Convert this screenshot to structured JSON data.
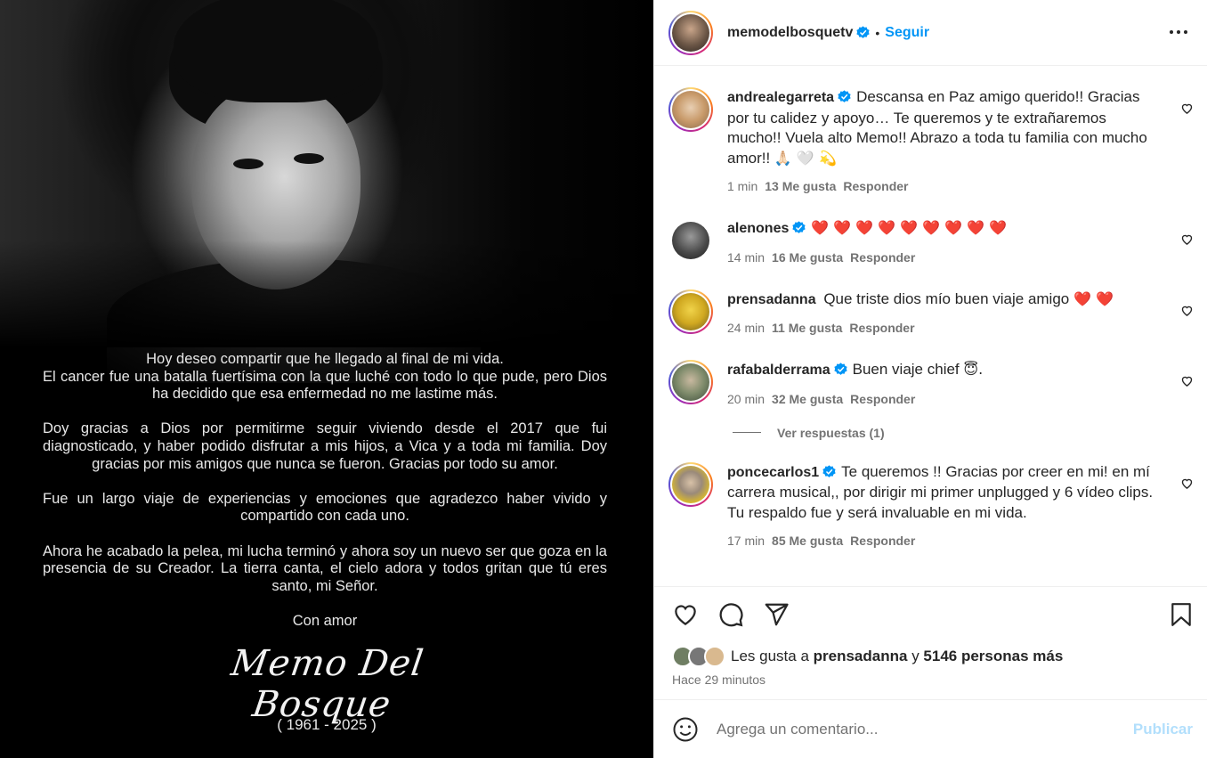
{
  "post": {
    "author": "memodelbosquetv",
    "follow_label": "Seguir",
    "separator": "•",
    "more_icon": "more-horizontal-icon"
  },
  "image": {
    "letter": [
      "Hoy deseo compartir que he llegado al final de mi vida.\nEl cancer fue una batalla fuertísima con la que luché con todo lo que pude, pero Dios ha decidido que esa enfermedad no me lastime más.",
      "Doy gracias a Dios por permitirme seguir viviendo desde el 2017 que fui diagnosticado, y haber podido disfrutar a mis hijos, a Vica y a toda mi familia. Doy gracias por mis amigos que nunca se fueron. Gracias por todo su amor.",
      "Fue un largo viaje de experiencias y emociones que agradezco haber vivido y compartido con cada uno.",
      "Ahora he acabado la pelea, mi lucha terminó y ahora soy un nuevo ser que goza en la presencia de su Creador.  La tierra canta, el cielo adora y todos gritan que tú eres santo, mi Señor.",
      "Con amor"
    ],
    "signature": "Memo Del Bosque",
    "dates": "( 1961 - 2025 )"
  },
  "comments": [
    {
      "user": "andrealegarreta",
      "verified": true,
      "text": "Descansa en Paz amigo querido!! Gracias por tu calidez y apoyo… Te queremos y te extrañaremos mucho!! Vuela alto Memo!! Abrazo a toda tu familia con mucho amor!!",
      "emojis": "🙏🏻 🤍 💫",
      "time": "1 min",
      "likes": "13 Me gusta",
      "reply": "Responder",
      "ring": true,
      "avatar_color": "#d9b98f"
    },
    {
      "user": "alenones",
      "verified": true,
      "text": "",
      "emojis": "❤️ ❤️ ❤️ ❤️ ❤️ ❤️ ❤️ ❤️ ❤️",
      "time": "14 min",
      "likes": "16 Me gusta",
      "reply": "Responder",
      "ring": false,
      "avatar_color": "#555555"
    },
    {
      "user": "prensadanna",
      "verified": false,
      "text": "Que triste dios mío buen viaje amigo",
      "emojis": "❤️ ❤️",
      "time": "24 min",
      "likes": "11 Me gusta",
      "reply": "Responder",
      "ring": true,
      "avatar_color": "#e0c23a"
    },
    {
      "user": "rafabalderrama",
      "verified": true,
      "text": "Buen viaje chief",
      "emojis": "😇.",
      "time": "20 min",
      "likes": "32 Me gusta",
      "reply": "Responder",
      "ring": true,
      "avatar_color": "#6f7e63"
    },
    {
      "user": "poncecarlos1",
      "verified": true,
      "text": "Te queremos !! Gracias por creer en mi! en mí carrera musical,, por dirigir mi primer unplugged y 6 vídeo clips. Tu respaldo fue y será invaluable en mi vida.",
      "emojis": "",
      "time": "17 min",
      "likes": "85 Me gusta",
      "reply": "Responder",
      "ring": true,
      "avatar_color": "#e6c21c"
    }
  ],
  "view_replies": "Ver respuestas (1)",
  "likes": {
    "prefix": "Les gusta a",
    "user": "prensadanna",
    "conj": "y",
    "others": "5146 personas más"
  },
  "time_ago": "Hace 29 minutos",
  "composer": {
    "placeholder": "Agrega un comentario...",
    "publish": "Publicar"
  },
  "colors": {
    "link": "#0095f6",
    "publish_disabled": "#b2dffc",
    "muted": "#737373",
    "heart": "#ed4956"
  }
}
